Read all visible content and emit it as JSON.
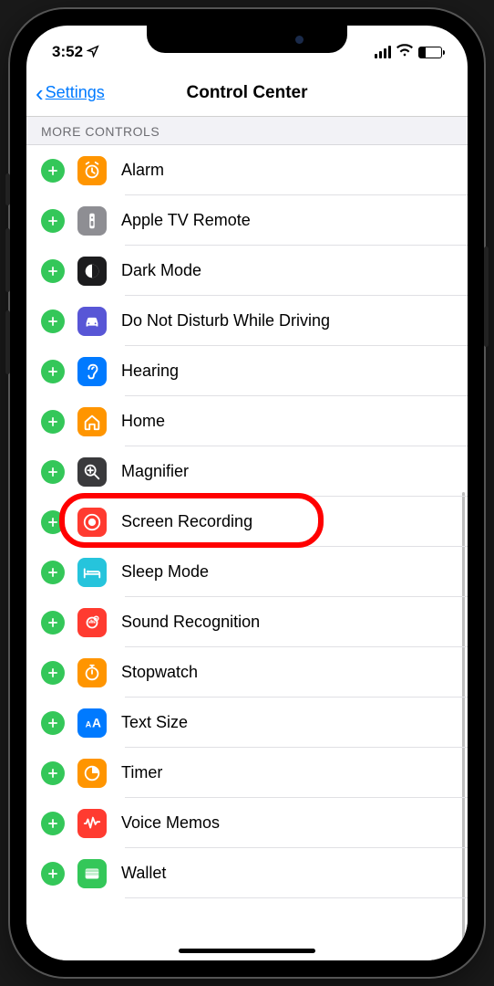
{
  "status": {
    "time": "3:52"
  },
  "nav": {
    "back_label": "Settings",
    "title": "Control Center"
  },
  "section": {
    "header": "MORE CONTROLS"
  },
  "controls": [
    {
      "label": "Alarm",
      "icon": "alarm",
      "bg": "ic-orange"
    },
    {
      "label": "Apple TV Remote",
      "icon": "remote",
      "bg": "ic-gray"
    },
    {
      "label": "Dark Mode",
      "icon": "darkmode",
      "bg": "ic-dark"
    },
    {
      "label": "Do Not Disturb While Driving",
      "icon": "car",
      "bg": "ic-purple"
    },
    {
      "label": "Hearing",
      "icon": "ear",
      "bg": "ic-blue"
    },
    {
      "label": "Home",
      "icon": "home",
      "bg": "ic-orange2"
    },
    {
      "label": "Magnifier",
      "icon": "magnifier",
      "bg": "ic-darkgray"
    },
    {
      "label": "Screen Recording",
      "icon": "record",
      "bg": "ic-red",
      "highlighted": true
    },
    {
      "label": "Sleep Mode",
      "icon": "bed",
      "bg": "ic-teal"
    },
    {
      "label": "Sound Recognition",
      "icon": "sound",
      "bg": "ic-redsound"
    },
    {
      "label": "Stopwatch",
      "icon": "stopwatch",
      "bg": "ic-orange"
    },
    {
      "label": "Text Size",
      "icon": "textsize",
      "bg": "ic-blue"
    },
    {
      "label": "Timer",
      "icon": "timer",
      "bg": "ic-orange"
    },
    {
      "label": "Voice Memos",
      "icon": "voicememo",
      "bg": "ic-redsound"
    },
    {
      "label": "Wallet",
      "icon": "wallet",
      "bg": "ic-green"
    }
  ]
}
